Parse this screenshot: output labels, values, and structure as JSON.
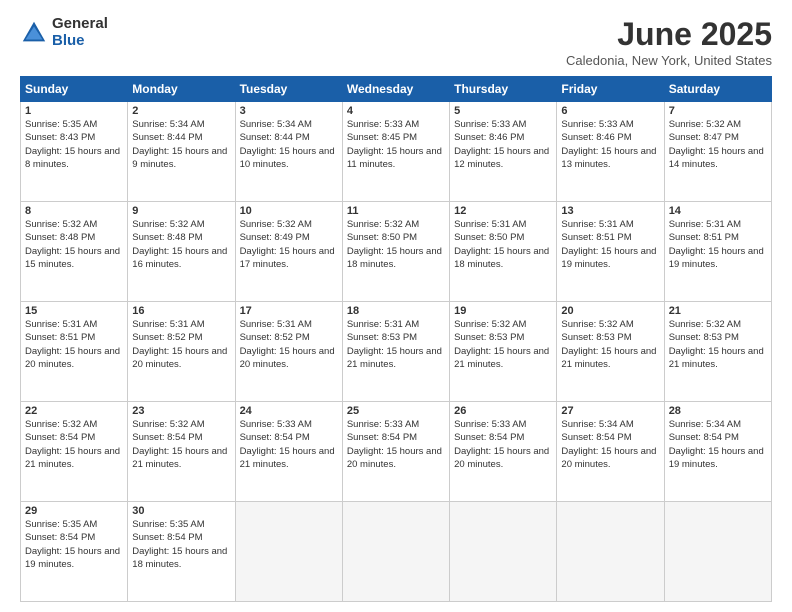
{
  "header": {
    "logo_general": "General",
    "logo_blue": "Blue",
    "month_title": "June 2025",
    "location": "Caledonia, New York, United States"
  },
  "calendar": {
    "headers": [
      "Sunday",
      "Monday",
      "Tuesday",
      "Wednesday",
      "Thursday",
      "Friday",
      "Saturday"
    ],
    "rows": [
      [
        {
          "day": "1",
          "sunrise": "Sunrise: 5:35 AM",
          "sunset": "Sunset: 8:43 PM",
          "daylight": "Daylight: 15 hours and 8 minutes."
        },
        {
          "day": "2",
          "sunrise": "Sunrise: 5:34 AM",
          "sunset": "Sunset: 8:44 PM",
          "daylight": "Daylight: 15 hours and 9 minutes."
        },
        {
          "day": "3",
          "sunrise": "Sunrise: 5:34 AM",
          "sunset": "Sunset: 8:44 PM",
          "daylight": "Daylight: 15 hours and 10 minutes."
        },
        {
          "day": "4",
          "sunrise": "Sunrise: 5:33 AM",
          "sunset": "Sunset: 8:45 PM",
          "daylight": "Daylight: 15 hours and 11 minutes."
        },
        {
          "day": "5",
          "sunrise": "Sunrise: 5:33 AM",
          "sunset": "Sunset: 8:46 PM",
          "daylight": "Daylight: 15 hours and 12 minutes."
        },
        {
          "day": "6",
          "sunrise": "Sunrise: 5:33 AM",
          "sunset": "Sunset: 8:46 PM",
          "daylight": "Daylight: 15 hours and 13 minutes."
        },
        {
          "day": "7",
          "sunrise": "Sunrise: 5:32 AM",
          "sunset": "Sunset: 8:47 PM",
          "daylight": "Daylight: 15 hours and 14 minutes."
        }
      ],
      [
        {
          "day": "8",
          "sunrise": "Sunrise: 5:32 AM",
          "sunset": "Sunset: 8:48 PM",
          "daylight": "Daylight: 15 hours and 15 minutes."
        },
        {
          "day": "9",
          "sunrise": "Sunrise: 5:32 AM",
          "sunset": "Sunset: 8:48 PM",
          "daylight": "Daylight: 15 hours and 16 minutes."
        },
        {
          "day": "10",
          "sunrise": "Sunrise: 5:32 AM",
          "sunset": "Sunset: 8:49 PM",
          "daylight": "Daylight: 15 hours and 17 minutes."
        },
        {
          "day": "11",
          "sunrise": "Sunrise: 5:32 AM",
          "sunset": "Sunset: 8:50 PM",
          "daylight": "Daylight: 15 hours and 18 minutes."
        },
        {
          "day": "12",
          "sunrise": "Sunrise: 5:31 AM",
          "sunset": "Sunset: 8:50 PM",
          "daylight": "Daylight: 15 hours and 18 minutes."
        },
        {
          "day": "13",
          "sunrise": "Sunrise: 5:31 AM",
          "sunset": "Sunset: 8:51 PM",
          "daylight": "Daylight: 15 hours and 19 minutes."
        },
        {
          "day": "14",
          "sunrise": "Sunrise: 5:31 AM",
          "sunset": "Sunset: 8:51 PM",
          "daylight": "Daylight: 15 hours and 19 minutes."
        }
      ],
      [
        {
          "day": "15",
          "sunrise": "Sunrise: 5:31 AM",
          "sunset": "Sunset: 8:51 PM",
          "daylight": "Daylight: 15 hours and 20 minutes."
        },
        {
          "day": "16",
          "sunrise": "Sunrise: 5:31 AM",
          "sunset": "Sunset: 8:52 PM",
          "daylight": "Daylight: 15 hours and 20 minutes."
        },
        {
          "day": "17",
          "sunrise": "Sunrise: 5:31 AM",
          "sunset": "Sunset: 8:52 PM",
          "daylight": "Daylight: 15 hours and 20 minutes."
        },
        {
          "day": "18",
          "sunrise": "Sunrise: 5:31 AM",
          "sunset": "Sunset: 8:53 PM",
          "daylight": "Daylight: 15 hours and 21 minutes."
        },
        {
          "day": "19",
          "sunrise": "Sunrise: 5:32 AM",
          "sunset": "Sunset: 8:53 PM",
          "daylight": "Daylight: 15 hours and 21 minutes."
        },
        {
          "day": "20",
          "sunrise": "Sunrise: 5:32 AM",
          "sunset": "Sunset: 8:53 PM",
          "daylight": "Daylight: 15 hours and 21 minutes."
        },
        {
          "day": "21",
          "sunrise": "Sunrise: 5:32 AM",
          "sunset": "Sunset: 8:53 PM",
          "daylight": "Daylight: 15 hours and 21 minutes."
        }
      ],
      [
        {
          "day": "22",
          "sunrise": "Sunrise: 5:32 AM",
          "sunset": "Sunset: 8:54 PM",
          "daylight": "Daylight: 15 hours and 21 minutes."
        },
        {
          "day": "23",
          "sunrise": "Sunrise: 5:32 AM",
          "sunset": "Sunset: 8:54 PM",
          "daylight": "Daylight: 15 hours and 21 minutes."
        },
        {
          "day": "24",
          "sunrise": "Sunrise: 5:33 AM",
          "sunset": "Sunset: 8:54 PM",
          "daylight": "Daylight: 15 hours and 21 minutes."
        },
        {
          "day": "25",
          "sunrise": "Sunrise: 5:33 AM",
          "sunset": "Sunset: 8:54 PM",
          "daylight": "Daylight: 15 hours and 20 minutes."
        },
        {
          "day": "26",
          "sunrise": "Sunrise: 5:33 AM",
          "sunset": "Sunset: 8:54 PM",
          "daylight": "Daylight: 15 hours and 20 minutes."
        },
        {
          "day": "27",
          "sunrise": "Sunrise: 5:34 AM",
          "sunset": "Sunset: 8:54 PM",
          "daylight": "Daylight: 15 hours and 20 minutes."
        },
        {
          "day": "28",
          "sunrise": "Sunrise: 5:34 AM",
          "sunset": "Sunset: 8:54 PM",
          "daylight": "Daylight: 15 hours and 19 minutes."
        }
      ],
      [
        {
          "day": "29",
          "sunrise": "Sunrise: 5:35 AM",
          "sunset": "Sunset: 8:54 PM",
          "daylight": "Daylight: 15 hours and 19 minutes."
        },
        {
          "day": "30",
          "sunrise": "Sunrise: 5:35 AM",
          "sunset": "Sunset: 8:54 PM",
          "daylight": "Daylight: 15 hours and 18 minutes."
        },
        {
          "day": "",
          "sunrise": "",
          "sunset": "",
          "daylight": ""
        },
        {
          "day": "",
          "sunrise": "",
          "sunset": "",
          "daylight": ""
        },
        {
          "day": "",
          "sunrise": "",
          "sunset": "",
          "daylight": ""
        },
        {
          "day": "",
          "sunrise": "",
          "sunset": "",
          "daylight": ""
        },
        {
          "day": "",
          "sunrise": "",
          "sunset": "",
          "daylight": ""
        }
      ]
    ]
  }
}
